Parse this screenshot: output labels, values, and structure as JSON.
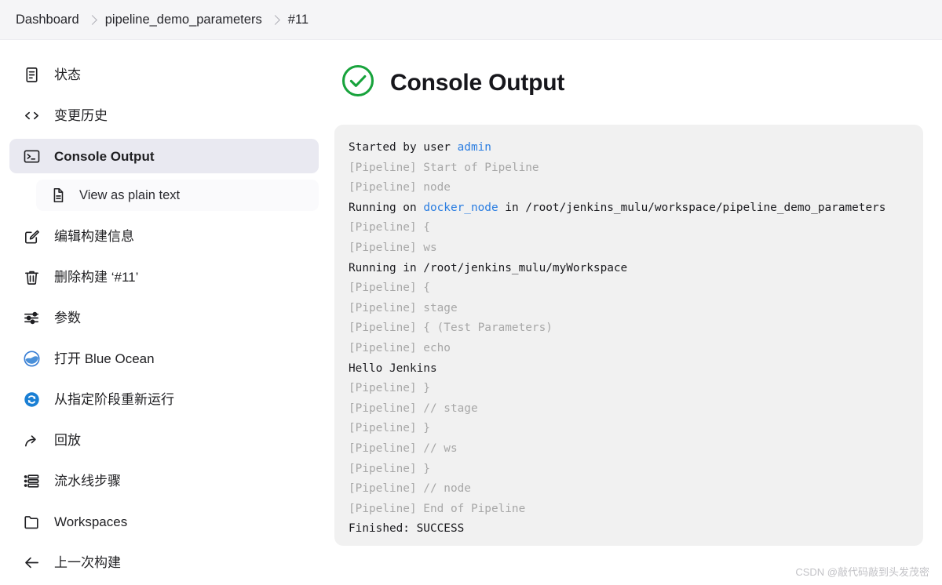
{
  "breadcrumb": {
    "items": [
      {
        "label": "Dashboard",
        "name": "breadcrumb-dashboard"
      },
      {
        "label": "pipeline_demo_parameters",
        "name": "breadcrumb-job"
      },
      {
        "label": "#11",
        "name": "breadcrumb-build"
      }
    ]
  },
  "sidebar": {
    "items": [
      {
        "label": "状态",
        "icon": "document-icon",
        "name": "sidebar-item-status",
        "active": false,
        "sub": false
      },
      {
        "label": "变更历史",
        "icon": "code-icon",
        "name": "sidebar-item-changes",
        "active": false,
        "sub": false
      },
      {
        "label": "Console Output",
        "icon": "terminal-icon",
        "name": "sidebar-item-console-output",
        "active": true,
        "sub": false
      },
      {
        "label": "View as plain text",
        "icon": "file-text-icon",
        "name": "sidebar-item-view-plain-text",
        "active": false,
        "sub": true
      },
      {
        "label": "编辑构建信息",
        "icon": "edit-icon",
        "name": "sidebar-item-edit-build-info",
        "active": false,
        "sub": false
      },
      {
        "label": "删除构建 ‘#11’",
        "icon": "trash-icon",
        "name": "sidebar-item-delete-build",
        "active": false,
        "sub": false
      },
      {
        "label": "参数",
        "icon": "sliders-icon",
        "name": "sidebar-item-parameters",
        "active": false,
        "sub": false
      },
      {
        "label": "打开 Blue Ocean",
        "icon": "blue-ocean-icon",
        "name": "sidebar-item-open-blue-ocean",
        "active": false,
        "sub": false
      },
      {
        "label": "从指定阶段重新运行",
        "icon": "restart-icon",
        "name": "sidebar-item-restart-from-stage",
        "active": false,
        "sub": false
      },
      {
        "label": "回放",
        "icon": "replay-icon",
        "name": "sidebar-item-replay",
        "active": false,
        "sub": false
      },
      {
        "label": "流水线步骤",
        "icon": "steps-icon",
        "name": "sidebar-item-pipeline-steps",
        "active": false,
        "sub": false
      },
      {
        "label": "Workspaces",
        "icon": "folder-icon",
        "name": "sidebar-item-workspaces",
        "active": false,
        "sub": false
      },
      {
        "label": "上一次构建",
        "icon": "arrow-left-icon",
        "name": "sidebar-item-previous-build",
        "active": false,
        "sub": false
      }
    ]
  },
  "main": {
    "title": "Console Output",
    "status_icon": "success-check-icon",
    "status_color": "#18a33c",
    "log_lines": [
      {
        "muted": false,
        "parts": [
          {
            "t": "Started by user "
          },
          {
            "t": "admin",
            "link": true
          }
        ]
      },
      {
        "muted": true,
        "parts": [
          {
            "t": "[Pipeline] Start of Pipeline"
          }
        ]
      },
      {
        "muted": true,
        "parts": [
          {
            "t": "[Pipeline] node"
          }
        ]
      },
      {
        "muted": false,
        "parts": [
          {
            "t": "Running on "
          },
          {
            "t": "docker_node",
            "link": true
          },
          {
            "t": " in /root/jenkins_mulu/workspace/pipeline_demo_parameters"
          }
        ]
      },
      {
        "muted": true,
        "parts": [
          {
            "t": "[Pipeline] {"
          }
        ]
      },
      {
        "muted": true,
        "parts": [
          {
            "t": "[Pipeline] ws"
          }
        ]
      },
      {
        "muted": false,
        "parts": [
          {
            "t": "Running in /root/jenkins_mulu/myWorkspace"
          }
        ]
      },
      {
        "muted": true,
        "parts": [
          {
            "t": "[Pipeline] {"
          }
        ]
      },
      {
        "muted": true,
        "parts": [
          {
            "t": "[Pipeline] stage"
          }
        ]
      },
      {
        "muted": true,
        "parts": [
          {
            "t": "[Pipeline] { (Test Parameters)"
          }
        ]
      },
      {
        "muted": true,
        "parts": [
          {
            "t": "[Pipeline] echo"
          }
        ]
      },
      {
        "muted": false,
        "parts": [
          {
            "t": "Hello Jenkins"
          }
        ]
      },
      {
        "muted": true,
        "parts": [
          {
            "t": "[Pipeline] }"
          }
        ]
      },
      {
        "muted": true,
        "parts": [
          {
            "t": "[Pipeline] // stage"
          }
        ]
      },
      {
        "muted": true,
        "parts": [
          {
            "t": "[Pipeline] }"
          }
        ]
      },
      {
        "muted": true,
        "parts": [
          {
            "t": "[Pipeline] // ws"
          }
        ]
      },
      {
        "muted": true,
        "parts": [
          {
            "t": "[Pipeline] }"
          }
        ]
      },
      {
        "muted": true,
        "parts": [
          {
            "t": "[Pipeline] // node"
          }
        ]
      },
      {
        "muted": true,
        "parts": [
          {
            "t": "[Pipeline] End of Pipeline"
          }
        ]
      },
      {
        "muted": false,
        "parts": [
          {
            "t": "Finished: SUCCESS"
          }
        ]
      }
    ]
  },
  "watermark": {
    "text": "CSDN @敲代码敲到头发茂密"
  }
}
